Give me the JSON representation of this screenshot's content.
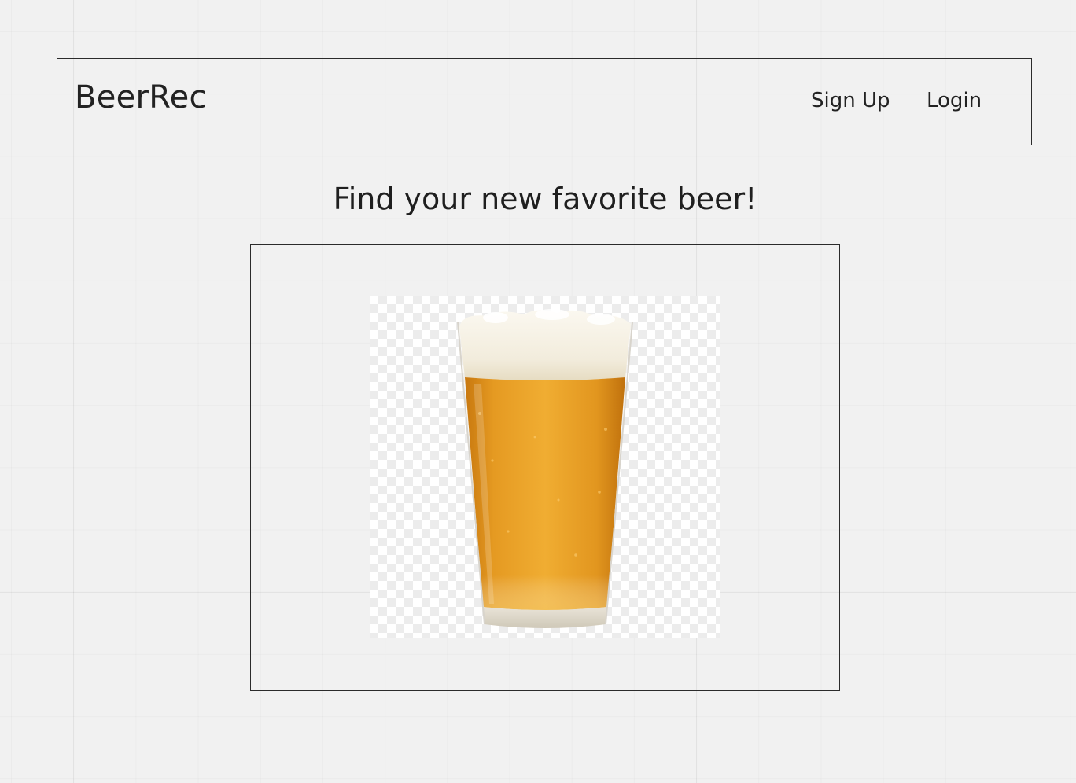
{
  "header": {
    "brand": "BeerRec",
    "nav": {
      "signup_label": "Sign Up",
      "login_label": "Login"
    }
  },
  "hero": {
    "headline": "Find your new favorite beer!",
    "image": {
      "subject": "pint-glass-of-beer",
      "background": "transparent-checkerboard"
    }
  },
  "colors": {
    "background": "#f1f1f1",
    "border": "#2b2b2b",
    "beer_amber": "#e4951f",
    "beer_foam": "#f6f1e4"
  }
}
